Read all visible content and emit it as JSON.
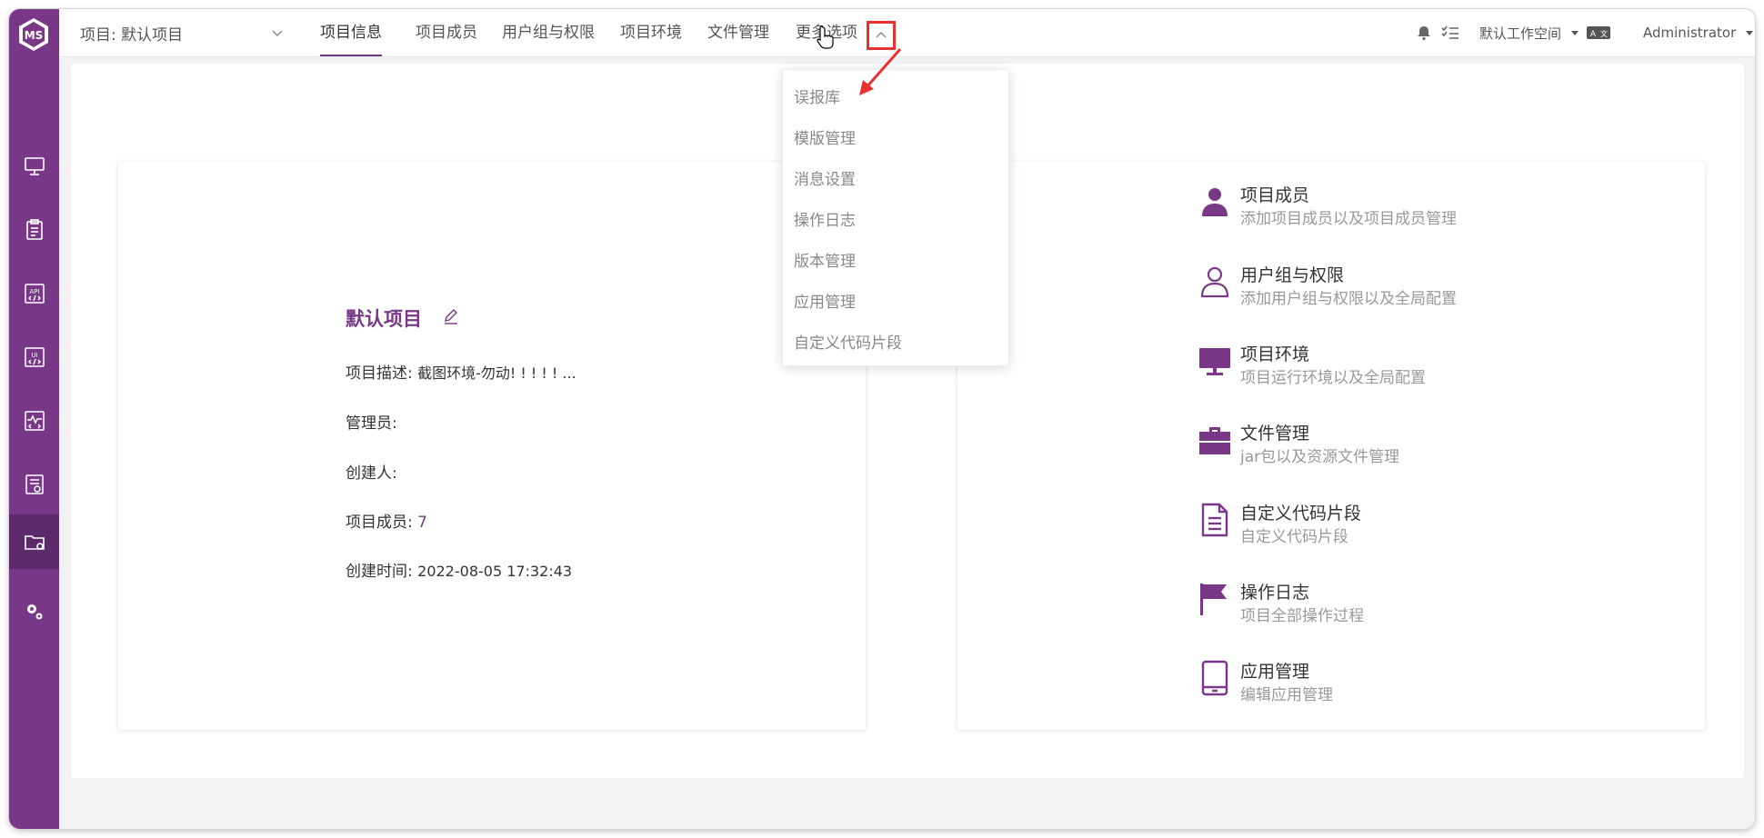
{
  "brand": {
    "logo_text": "MS",
    "accent": "#783887",
    "accent_dark": "#5c2a6a",
    "highlight": "#e8302e"
  },
  "sidebar": {
    "items": [
      {
        "icon": "monitor-icon"
      },
      {
        "icon": "clipboard-icon"
      },
      {
        "icon": "api-icon",
        "text": "API"
      },
      {
        "icon": "ui-icon",
        "text": "UI"
      },
      {
        "icon": "performance-icon"
      },
      {
        "icon": "report-icon"
      },
      {
        "icon": "project-folder-icon",
        "active": true
      },
      {
        "icon": "settings-gears-icon"
      }
    ]
  },
  "header": {
    "project_select": "项目: 默认项目",
    "tabs": [
      {
        "label": "项目信息",
        "active": true
      },
      {
        "label": "项目成员"
      },
      {
        "label": "用户组与权限"
      },
      {
        "label": "项目环境"
      },
      {
        "label": "文件管理"
      },
      {
        "label": "更多选项"
      }
    ],
    "workspace": "默认工作空间",
    "user": "Administrator"
  },
  "dropdown": {
    "items": [
      "误报库",
      "模版管理",
      "消息设置",
      "操作日志",
      "版本管理",
      "应用管理",
      "自定义代码片段"
    ]
  },
  "project_info": {
    "name": "默认项目",
    "rows": [
      {
        "label": "项目描述:",
        "value": "截图环境-勿动! ! ! ! ! ..."
      },
      {
        "label": "管理员:",
        "value": ""
      },
      {
        "label": "创建人:",
        "value": ""
      },
      {
        "label": "项目成员:",
        "value": "7"
      },
      {
        "label": "创建时间:",
        "value": "2022-08-05 17:32:43"
      }
    ]
  },
  "features": [
    {
      "icon": "user-filled-icon",
      "title": "项目成员",
      "desc": "添加项目成员以及项目成员管理"
    },
    {
      "icon": "user-outline-icon",
      "title": "用户组与权限",
      "desc": "添加用户组与权限以及全局配置"
    },
    {
      "icon": "monitor-icon",
      "title": "项目环境",
      "desc": "项目运行环境以及全局配置"
    },
    {
      "icon": "briefcase-icon",
      "title": "文件管理",
      "desc": "jar包以及资源文件管理"
    },
    {
      "icon": "document-icon",
      "title": "自定义代码片段",
      "desc": "自定义代码片段"
    },
    {
      "icon": "flag-icon",
      "title": "操作日志",
      "desc": "项目全部操作过程"
    },
    {
      "icon": "tablet-icon",
      "title": "应用管理",
      "desc": "编辑应用管理"
    }
  ]
}
